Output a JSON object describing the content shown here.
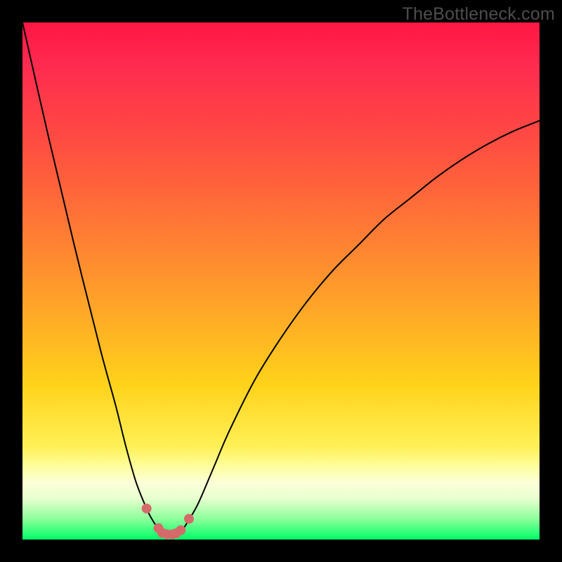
{
  "watermark": "TheBottleneck.com",
  "chart_data": {
    "type": "line",
    "title": "",
    "xlabel": "",
    "ylabel": "",
    "xlim": [
      0,
      100
    ],
    "ylim": [
      0,
      100
    ],
    "gradient_stops": [
      {
        "pct": 0,
        "color": "#ff1744"
      },
      {
        "pct": 8,
        "color": "#ff2a50"
      },
      {
        "pct": 25,
        "color": "#ff5140"
      },
      {
        "pct": 40,
        "color": "#ff7a35"
      },
      {
        "pct": 55,
        "color": "#ffa528"
      },
      {
        "pct": 70,
        "color": "#ffd21a"
      },
      {
        "pct": 82,
        "color": "#fff056"
      },
      {
        "pct": 86,
        "color": "#fdfea0"
      },
      {
        "pct": 89,
        "color": "#fcffd8"
      },
      {
        "pct": 92,
        "color": "#e8ffcf"
      },
      {
        "pct": 96,
        "color": "#8dff9b"
      },
      {
        "pct": 100,
        "color": "#00ff66"
      }
    ],
    "series": [
      {
        "name": "bottleneck-curve",
        "x": [
          0,
          5,
          10,
          15,
          18,
          20,
          22,
          24,
          25,
          26,
          27,
          28,
          29,
          30,
          31,
          32,
          34,
          37,
          40,
          45,
          50,
          55,
          60,
          65,
          70,
          75,
          80,
          85,
          90,
          95,
          100
        ],
        "y": [
          100,
          78,
          57,
          37,
          26,
          18,
          11,
          6,
          4,
          2.5,
          1.5,
          1,
          1,
          1.3,
          2,
          3.5,
          7,
          14,
          21,
          31,
          39,
          46,
          52,
          57,
          62,
          66,
          70,
          73.5,
          76.5,
          79,
          81
        ]
      }
    ],
    "markers": {
      "name": "bottom-cluster",
      "color": "#d66a6a",
      "radius_px": 7,
      "points": [
        {
          "x": 24.0,
          "y": 6.0
        },
        {
          "x": 26.3,
          "y": 2.2
        },
        {
          "x": 27.0,
          "y": 1.3
        },
        {
          "x": 28.0,
          "y": 1.0
        },
        {
          "x": 29.0,
          "y": 1.0
        },
        {
          "x": 29.7,
          "y": 1.2
        },
        {
          "x": 30.6,
          "y": 1.8
        },
        {
          "x": 32.2,
          "y": 4.0
        }
      ]
    }
  }
}
